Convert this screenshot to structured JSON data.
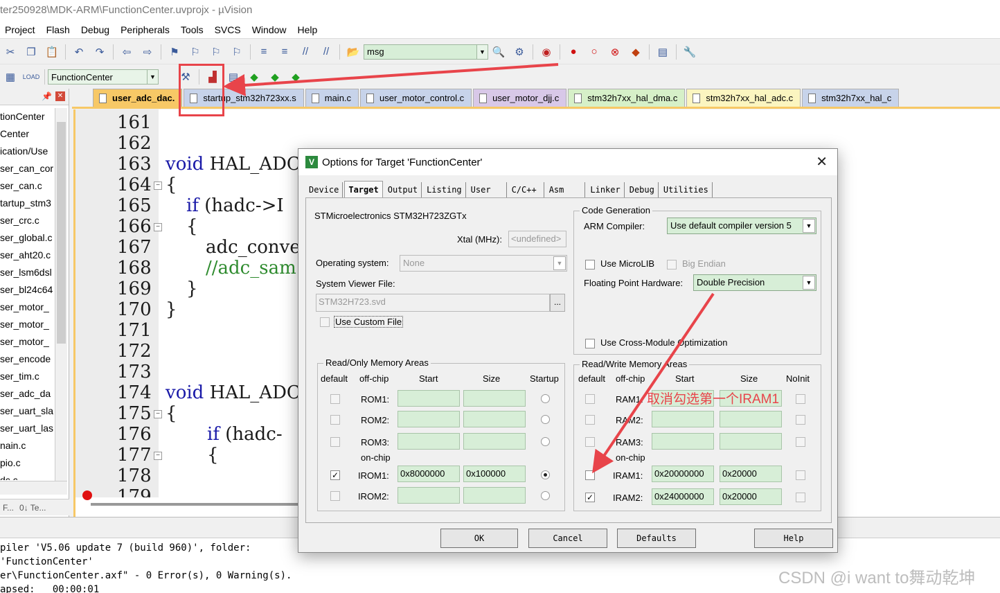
{
  "window": {
    "title": "ter250928\\MDK-ARM\\FunctionCenter.uvprojx - µVision"
  },
  "menu": [
    "Project",
    "Flash",
    "Debug",
    "Peripherals",
    "Tools",
    "SVCS",
    "Window",
    "Help"
  ],
  "toolbar": {
    "find_value": "msg",
    "target_value": "FunctionCenter"
  },
  "project_panel": {
    "items": [
      "tionCenter",
      "Center",
      "ication/Use",
      "ser_can_cor",
      "ser_can.c",
      "tartup_stm3",
      "ser_crc.c",
      "ser_global.c",
      "ser_aht20.c",
      "ser_lsm6dsl",
      "ser_bl24c64",
      "ser_motor_",
      "ser_motor_",
      "ser_motor_",
      "ser_encode",
      "ser_tim.c",
      "ser_adc_da",
      "ser_uart_sla",
      "ser_uart_las",
      "nain.c",
      "pio.c",
      "dc.c"
    ],
    "bottom_tabs": [
      "F...",
      "0↓ Te..."
    ]
  },
  "file_tabs": [
    "user_adc_dac.",
    "startup_stm32h723xx.s",
    "main.c",
    "user_motor_control.c",
    "user_motor_djj.c",
    "stm32h7xx_hal_dma.c",
    "stm32h7xx_hal_adc.c",
    "stm32h7xx_hal_c"
  ],
  "editor": {
    "line_numbers": [
      "161",
      "162",
      "163",
      "164",
      "165",
      "166",
      "167",
      "168",
      "169",
      "170",
      "171",
      "172",
      "173",
      "174",
      "175",
      "176",
      "177",
      "178",
      "179"
    ],
    "code": {
      "l163_kw": "void",
      "l163": " HAL_ADC_",
      "l164": "{",
      "l165_kw": "if",
      "l165": " (hadc->I",
      "l166": "{",
      "l167": "adc_conve",
      "l168": "//adc_sam",
      "l169": "}",
      "l170": "}",
      "l174_kw": "void",
      "l174": " HAL_ADC_",
      "l175": "{",
      "l176_kw": "if",
      "l176": " (hadc-",
      "l177": "{"
    }
  },
  "build_output": {
    "lines": [
      "piler 'V5.06 update 7 (build 960)', folder:",
      "'FunctionCenter'",
      "er\\FunctionCenter.axf\" - 0 Error(s), 0 Warning(s).",
      "apsed:   00:00:01"
    ]
  },
  "dialog": {
    "title": "Options for Target 'FunctionCenter'",
    "tabs": [
      "Device",
      "Target",
      "Output",
      "Listing",
      "User",
      "C/C++",
      "Asm",
      "Linker",
      "Debug",
      "Utilities"
    ],
    "active_tab": "Target",
    "device_name": "STMicroelectronics STM32H723ZGTx",
    "xtal_label": "Xtal (MHz):",
    "xtal_value": "<undefined>",
    "os_label": "Operating system:",
    "os_value": "None",
    "svd_label": "System Viewer File:",
    "svd_value": "STM32H723.svd",
    "svd_browse": "...",
    "use_custom_file": "Use Custom File",
    "code_gen": {
      "title": "Code Generation",
      "compiler_label": "ARM Compiler:",
      "compiler_value": "Use default compiler version 5",
      "microlib": "Use MicroLIB",
      "big_endian": "Big Endian",
      "fpu_label": "Floating Point Hardware:",
      "fpu_value": "Double Precision",
      "cross_module": "Use Cross-Module Optimization"
    },
    "ro_mem": {
      "title": "Read/Only Memory Areas",
      "headers": {
        "default": "default",
        "offchip": "off-chip",
        "start": "Start",
        "size": "Size",
        "startup": "Startup"
      },
      "onchip_label": "on-chip",
      "rows": [
        {
          "name": "ROM1:",
          "start": "",
          "size": "",
          "default": false,
          "startup": false
        },
        {
          "name": "ROM2:",
          "start": "",
          "size": "",
          "default": false,
          "startup": false
        },
        {
          "name": "ROM3:",
          "start": "",
          "size": "",
          "default": false,
          "startup": false
        },
        {
          "name": "IROM1:",
          "start": "0x8000000",
          "size": "0x100000",
          "default": true,
          "startup": true
        },
        {
          "name": "IROM2:",
          "start": "",
          "size": "",
          "default": false,
          "startup": false
        }
      ]
    },
    "rw_mem": {
      "title": "Read/Write Memory Areas",
      "headers": {
        "default": "default",
        "offchip": "off-chip",
        "start": "Start",
        "size": "Size",
        "noinit": "NoInit"
      },
      "onchip_label": "on-chip",
      "rows": [
        {
          "name": "RAM1:",
          "start": "",
          "size": "",
          "default": false
        },
        {
          "name": "RAM2:",
          "start": "",
          "size": "",
          "default": false
        },
        {
          "name": "RAM3:",
          "start": "",
          "size": "",
          "default": false
        },
        {
          "name": "IRAM1:",
          "start": "0x20000000",
          "size": "0x20000",
          "default": false
        },
        {
          "name": "IRAM2:",
          "start": "0x24000000",
          "size": "0x20000",
          "default": true
        }
      ]
    },
    "buttons": {
      "ok": "OK",
      "cancel": "Cancel",
      "defaults": "Defaults",
      "help": "Help"
    }
  },
  "annotation": {
    "text": "取消勾选第一个IRAM1",
    "color": "#e8444a"
  },
  "watermark": "CSDN @i want to舞动乾坤"
}
